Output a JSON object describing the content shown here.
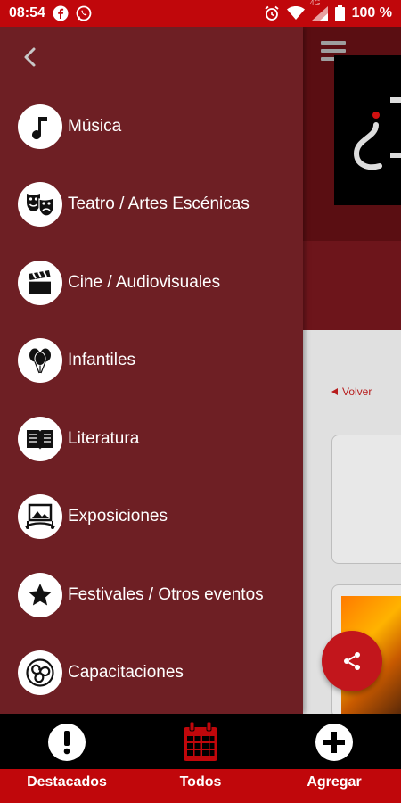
{
  "status_bar": {
    "time": "08:54",
    "signal_text": "4G",
    "battery": "100 %",
    "icons": [
      "facebook-icon",
      "whatsapp-icon",
      "alarm-icon",
      "wifi-icon",
      "signal-icon",
      "battery-icon"
    ]
  },
  "drawer": {
    "back_icon": "chevron-left-icon",
    "items": [
      {
        "label": "Música",
        "icon": "music-note-icon"
      },
      {
        "label": "Teatro / Artes Escénicas",
        "icon": "theater-masks-icon"
      },
      {
        "label": "Cine / Audiovisuales",
        "icon": "clapperboard-icon"
      },
      {
        "label": "Infantiles",
        "icon": "balloons-icon"
      },
      {
        "label": "Literatura",
        "icon": "book-icon"
      },
      {
        "label": "Exposiciones",
        "icon": "picture-frame-icon"
      },
      {
        "label": "Festivales / Otros eventos",
        "icon": "star-icon"
      },
      {
        "label": "Capacitaciones",
        "icon": "triskelion-icon"
      }
    ]
  },
  "background": {
    "back_link": "Volver",
    "menu_icon": "hamburger-icon"
  },
  "fab": {
    "icon": "share-icon"
  },
  "bottom_nav": {
    "items": [
      {
        "label": "Destacados",
        "icon": "exclamation-circle-icon"
      },
      {
        "label": "Todos",
        "icon": "calendar-icon"
      },
      {
        "label": "Agregar",
        "icon": "plus-circle-icon"
      }
    ]
  },
  "colors": {
    "accent": "#c0070b",
    "drawer": "#6e1f24",
    "nav_background": "#000000"
  }
}
